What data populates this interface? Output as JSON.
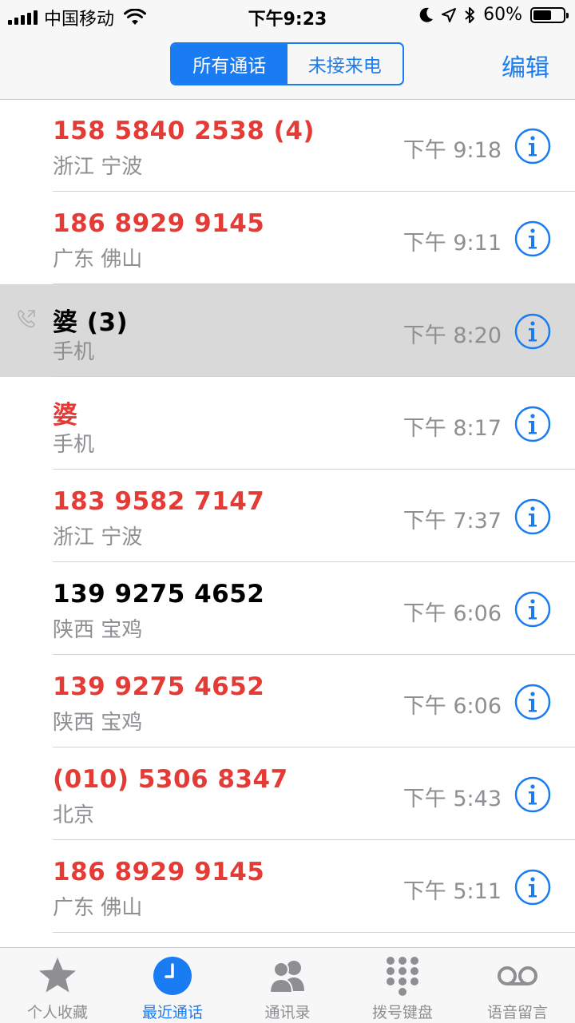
{
  "status_bar": {
    "carrier": "中国移动",
    "time": "下午9:23",
    "battery_pct": "60%",
    "battery_level": 0.6
  },
  "nav": {
    "segments": [
      {
        "label": "所有通话",
        "active": true
      },
      {
        "label": "未接来电",
        "active": false
      }
    ],
    "edit_label": "编辑"
  },
  "calls": [
    {
      "name": "158 5840 2538 (4)",
      "sub": "浙江 宁波",
      "time": "下午 9:18",
      "missed": true
    },
    {
      "name": "186 8929 9145",
      "sub": "广东 佛山",
      "time": "下午 9:11",
      "missed": true
    },
    {
      "name": "婆 (3)",
      "sub": "手机",
      "time": "下午 8:20",
      "missed": false,
      "outgoing": true,
      "selected": true
    },
    {
      "name": "婆",
      "sub": "手机",
      "time": "下午 8:17",
      "missed": true
    },
    {
      "name": "183 9582 7147",
      "sub": "浙江 宁波",
      "time": "下午 7:37",
      "missed": true
    },
    {
      "name": "139 9275 4652",
      "sub": "陕西 宝鸡",
      "time": "下午 6:06",
      "missed": false
    },
    {
      "name": "139 9275 4652",
      "sub": "陕西 宝鸡",
      "time": "下午 6:06",
      "missed": true
    },
    {
      "name": "(010) 5306 8347",
      "sub": "北京",
      "time": "下午 5:43",
      "missed": true
    },
    {
      "name": "186 8929 9145",
      "sub": "广东 佛山",
      "time": "下午 5:11",
      "missed": true
    }
  ],
  "tabs": [
    {
      "label": "个人收藏",
      "icon": "star-icon",
      "active": false
    },
    {
      "label": "最近通话",
      "icon": "clock-icon",
      "active": true
    },
    {
      "label": "通讯录",
      "icon": "contacts-icon",
      "active": false
    },
    {
      "label": "拨号键盘",
      "icon": "keypad-icon",
      "active": false
    },
    {
      "label": "语音留言",
      "icon": "voicemail-icon",
      "active": false
    }
  ],
  "colors": {
    "accent": "#1a7cf2",
    "missed": "#e43b36",
    "secondary_text": "#8e8e93",
    "selected_row": "#d9d9d9"
  }
}
